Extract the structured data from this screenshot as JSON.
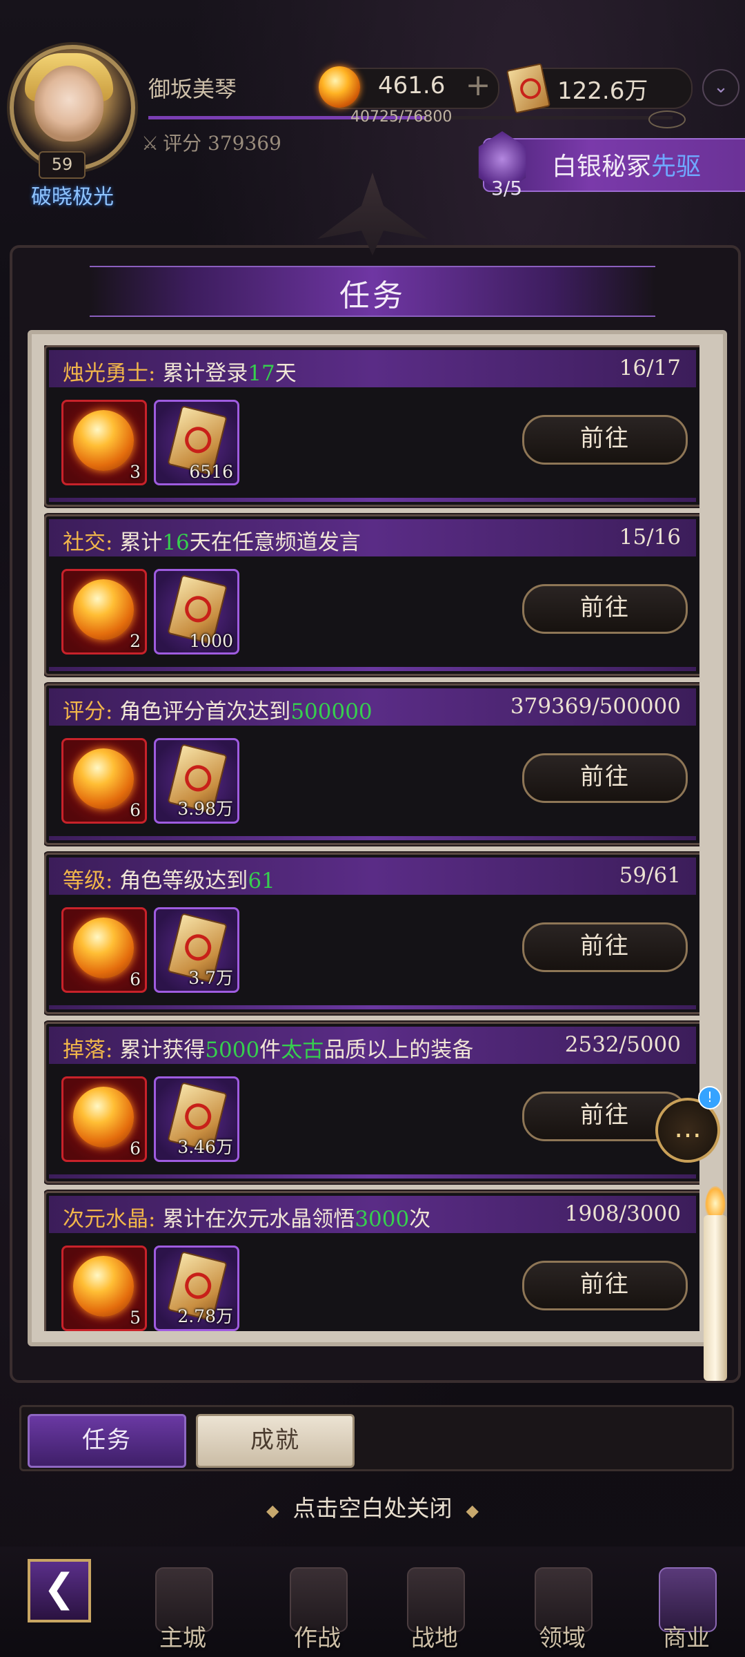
{
  "header": {
    "player_name": "御坂美琴",
    "level": "59",
    "title": "破晓极光",
    "score": "评分 379369",
    "gold_orb": "461.6",
    "card_currency": "122.6万",
    "exp": "40725/76800",
    "exp_fraction": 0.53,
    "plus": "+",
    "dropdown": "⌄"
  },
  "event": {
    "label_main": "白银秘冢",
    "label_accent": "先驱",
    "progress": "3/5"
  },
  "panel": {
    "title": "任务"
  },
  "tasks": [
    {
      "cat": "烛光勇士:",
      "pre": "累计登录",
      "hl": "17",
      "mid": "天",
      "hl2": "",
      "post": "",
      "progress": "16/17",
      "orb_qty": "3",
      "card_qty": "6516",
      "button": "前往"
    },
    {
      "cat": "社交:",
      "pre": "累计",
      "hl": "16",
      "mid": "天在任意频道发言",
      "hl2": "",
      "post": "",
      "progress": "15/16",
      "orb_qty": "2",
      "card_qty": "1000",
      "button": "前往"
    },
    {
      "cat": "评分:",
      "pre": "角色评分首次达到",
      "hl": "500000",
      "mid": "",
      "hl2": "",
      "post": "",
      "progress": "379369/500000",
      "orb_qty": "6",
      "card_qty": "3.98万",
      "button": "前往"
    },
    {
      "cat": "等级:",
      "pre": "角色等级达到",
      "hl": "61",
      "mid": "",
      "hl2": "",
      "post": "",
      "progress": "59/61",
      "orb_qty": "6",
      "card_qty": "3.7万",
      "button": "前往"
    },
    {
      "cat": "掉落:",
      "pre": "累计获得",
      "hl": "5000",
      "mid": "件",
      "hl2": "太古",
      "post": "品质以上的装备",
      "progress": "2532/5000",
      "orb_qty": "6",
      "card_qty": "3.46万",
      "button": "前往"
    },
    {
      "cat": "次元水晶:",
      "pre": "累计在次元水晶领悟",
      "hl": "3000",
      "mid": "次",
      "hl2": "",
      "post": "",
      "progress": "1908/3000",
      "orb_qty": "5",
      "card_qty": "2.78万",
      "button": "前往"
    }
  ],
  "tabs": {
    "active": "任务",
    "inactive": "成就"
  },
  "close_hint": "点击空白处关闭",
  "chat": {
    "icon": "…",
    "alert": "!"
  },
  "bottom_nav": {
    "back": "❮",
    "items": [
      "主城",
      "作战",
      "战地",
      "领域",
      "商业"
    ]
  },
  "colors": {
    "accent_purple": "#6f36a3",
    "highlight_green": "#36d04e",
    "category_gold": "#f1b64a",
    "event_blue": "#6fa8ff"
  }
}
